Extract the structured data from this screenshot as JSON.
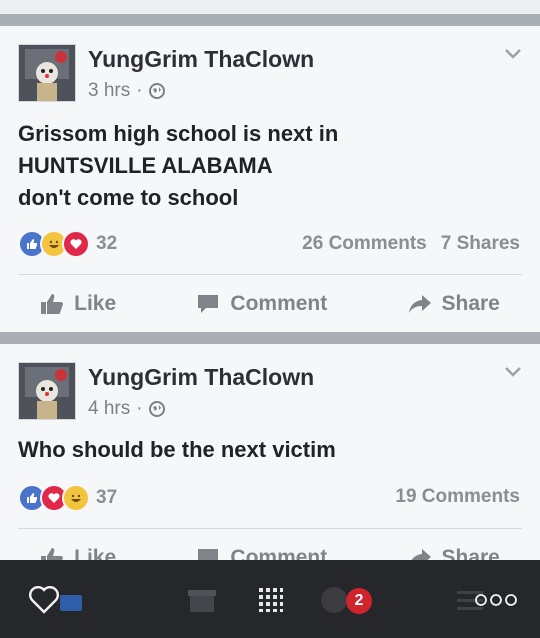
{
  "posts": [
    {
      "author": "YungGrim ThaClown",
      "time": "3 hrs",
      "dot": "·",
      "text_lines": [
        "Grissom high school is next in",
        "HUNTSVILLE ALABAMA",
        "don't come to school"
      ],
      "reaction_icons": [
        "like",
        "haha",
        "love"
      ],
      "reaction_count": "32",
      "comments": "26 Comments",
      "shares": "7 Shares",
      "actions": {
        "like": "Like",
        "comment": "Comment",
        "share": "Share"
      }
    },
    {
      "author": "YungGrim ThaClown",
      "time": "4 hrs",
      "dot": "·",
      "text_lines": [
        "Who should be the next victim"
      ],
      "reaction_icons": [
        "like",
        "love",
        "haha"
      ],
      "reaction_count": "37",
      "comments": "19 Comments",
      "actions": {
        "like": "Like",
        "comment": "Comment",
        "share": "Share"
      }
    }
  ],
  "tabbar": {
    "notification_badge": "2",
    "icons": [
      "heart-icon",
      "news-feed-icon",
      "marketplace-icon",
      "grid-icon",
      "notifications-icon",
      "more-icon"
    ]
  },
  "colors": {
    "like_blue": "#4a74c9",
    "love_red": "#e0294a",
    "haha_yellow": "#f3c43d",
    "badge_red": "#d0242c"
  }
}
